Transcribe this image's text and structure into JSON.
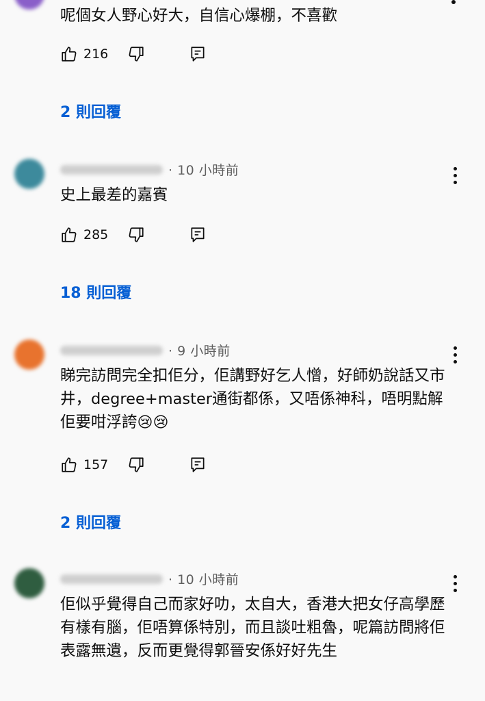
{
  "comments": [
    {
      "time": "",
      "text": "呢個女人野心好大，自信心爆棚，不喜歡",
      "likes": "216",
      "replies": "2 則回覆"
    },
    {
      "time": "· 10 小時前",
      "text": "史上最差的嘉賓",
      "likes": "285",
      "replies": "18 則回覆",
      "avatar_color": "#3d8a9c"
    },
    {
      "time": "· 9 小時前",
      "text": "睇完訪問完全扣佢分，佢講野好乞人憎，好師奶說話又市井，degree+master通街都係，又唔係神科，唔明點解佢要咁浮誇",
      "emoji": "😢😢",
      "likes": "157",
      "replies": "2 則回覆",
      "avatar_color": "#e8732e"
    },
    {
      "time": "· 10 小時前",
      "text": "佢似乎覺得自己而家好叻，太自大，香港大把女仔高學歷有樣有腦，佢唔算係特別，而且談吐粗魯，呢篇訪問將佢表露無遺，反而更覺得郭晉安係好好先生",
      "avatar_color": "#2f5d40"
    }
  ],
  "icons": {
    "like": "thumbs-up-icon",
    "dislike": "thumbs-down-icon",
    "reply": "reply-comment-icon",
    "more": "more-vert-icon"
  },
  "colors": {
    "link": "#065fd4",
    "meta": "#606060",
    "background": "#f9f9f9"
  }
}
